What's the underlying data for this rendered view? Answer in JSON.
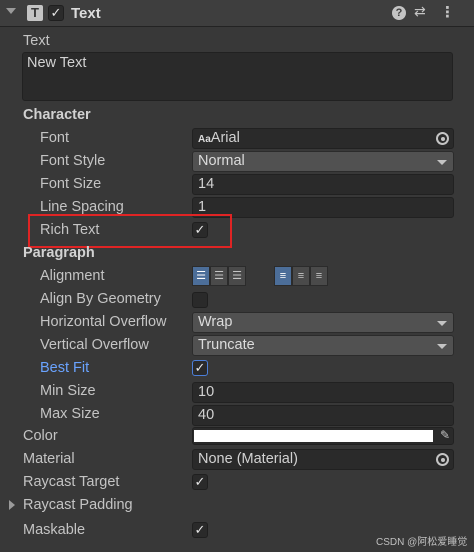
{
  "header": {
    "component_name": "Text",
    "component_icon": "T",
    "enabled_check": "✓",
    "help_icon": "?",
    "presets_icon": "⇄",
    "menu_icon": "⋮"
  },
  "text": {
    "label": "Text",
    "value": "New Text"
  },
  "character": {
    "section_label": "Character",
    "font_label": "Font",
    "font_icon": "Aa",
    "font_value": "Arial",
    "font_style_label": "Font Style",
    "font_style_value": "Normal",
    "font_size_label": "Font Size",
    "font_size_value": "14",
    "line_spacing_label": "Line Spacing",
    "line_spacing_value": "1",
    "rich_text_label": "Rich Text",
    "rich_text_checked": "✓"
  },
  "paragraph": {
    "section_label": "Paragraph",
    "alignment_label": "Alignment",
    "align_by_geometry_label": "Align By Geometry",
    "horizontal_overflow_label": "Horizontal Overflow",
    "horizontal_overflow_value": "Wrap",
    "vertical_overflow_label": "Vertical Overflow",
    "vertical_overflow_value": "Truncate",
    "best_fit_label": "Best Fit",
    "best_fit_checked": "✓",
    "min_size_label": "Min Size",
    "min_size_value": "10",
    "max_size_label": "Max Size",
    "max_size_value": "40"
  },
  "color": {
    "label": "Color",
    "swatch_hex": "#ffffff",
    "eyedropper_icon": "✎"
  },
  "material": {
    "label": "Material",
    "value": "None (Material)"
  },
  "raycast_target": {
    "label": "Raycast Target",
    "checked": "✓"
  },
  "raycast_padding": {
    "label": "Raycast Padding"
  },
  "maskable": {
    "label": "Maskable",
    "checked": "✓"
  },
  "watermark": "CSDN @阿松爱睡觉",
  "colors": {
    "background": "#383838",
    "accent_blue": "#6aa3ff",
    "highlight_red": "#e02424"
  }
}
